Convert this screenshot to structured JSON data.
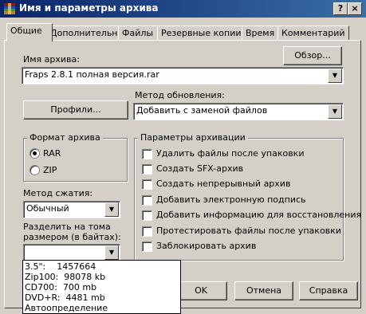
{
  "window": {
    "title": "Имя и параметры архива",
    "help_btn": "?",
    "close_btn": "×"
  },
  "tabs": [
    {
      "label": "Общие",
      "active": true
    },
    {
      "label": "Дополнительно"
    },
    {
      "label": "Файлы"
    },
    {
      "label": "Резервные копии"
    },
    {
      "label": "Время"
    },
    {
      "label": "Комментарий"
    }
  ],
  "archive_name": {
    "label": "Имя архива:",
    "value": "Fraps 2.8.1 полная версия.rar",
    "browse_button": "Обзор..."
  },
  "update_method": {
    "label": "Метод обновления:",
    "value": "Добавить с заменой файлов"
  },
  "profiles_button": "Профили...",
  "archive_format": {
    "label": "Формат архива",
    "options": [
      {
        "label": "RAR",
        "selected": true
      },
      {
        "label": "ZIP",
        "selected": false
      }
    ]
  },
  "compression": {
    "label": "Метод сжатия:",
    "value": "Обычный"
  },
  "split": {
    "label_line1": "Разделить на тома",
    "label_line2": "размером (в байтах):",
    "value": "",
    "options": [
      {
        "name": "3.5\":",
        "size": "1457664"
      },
      {
        "name": "Zip100:",
        "size": "98078 kb"
      },
      {
        "name": "CD700:",
        "size": "700 mb"
      },
      {
        "name": "DVD+R:",
        "size": "4481 mb"
      },
      {
        "name": "Автоопределение",
        "size": ""
      }
    ]
  },
  "archive_options": {
    "label": "Параметры архивации",
    "items": [
      {
        "label": "Удалить файлы после упаковки",
        "checked": false
      },
      {
        "label": "Создать SFX-архив",
        "checked": false
      },
      {
        "label": "Создать непрерывный архив",
        "checked": false
      },
      {
        "label": "Добавить электронную подпись",
        "checked": false
      },
      {
        "label": "Добавить информацию для восстановления",
        "checked": false
      },
      {
        "label": "Протестировать файлы после упаковки",
        "checked": false
      },
      {
        "label": "Заблокировать архив",
        "checked": false
      }
    ]
  },
  "buttons": {
    "ok": "OK",
    "cancel": "Отмена",
    "help": "Справка"
  }
}
